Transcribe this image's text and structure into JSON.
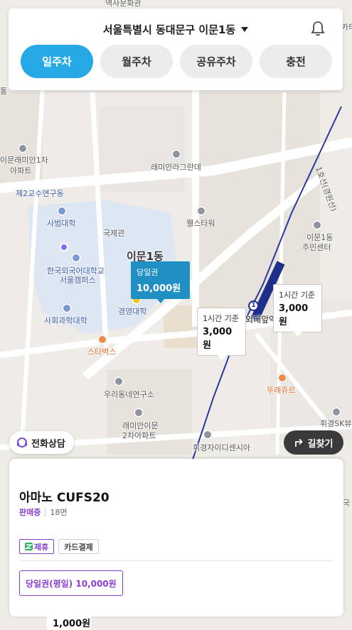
{
  "header": {
    "location": "서울특별시 동대문구 이문1동",
    "tabs": [
      {
        "label": "일주차",
        "active": true
      },
      {
        "label": "월주차",
        "active": false
      },
      {
        "label": "공유주차",
        "active": false
      },
      {
        "label": "충전",
        "active": false
      }
    ]
  },
  "map": {
    "labels": {
      "top_partial": "역사문화관",
      "left_apt_a": "이문래미안1차",
      "left_apt_b": "아파트",
      "research": "제2교수연구동",
      "edu": "사범대학",
      "faculty": "국제관",
      "district": "이문1동",
      "campus_a": "한국외국어대학교",
      "campus_b": "서울캠퍼스",
      "social": "사회과학대학",
      "business": "경영대학",
      "starbucks": "스타벅스",
      "center": "우리동네연구소",
      "apt2_a": "래미안이문",
      "apt2_b": "2차아파트",
      "raemian_green": "래미안라그란데",
      "wells": "웰스타워",
      "dong_center_a": "이문1동",
      "dong_center_b": "주민센터",
      "station": "외대앞역",
      "station_num": "1",
      "line": "1호선(경원선)",
      "tous": "뚜레쥬르",
      "hwigyeong_center": "휘경자이디센시아",
      "hwigyeong_sk": "휘경SK뷰",
      "right_edge": "국",
      "left_edge": "통",
      "top_right_edge": "카티"
    }
  },
  "markers": [
    {
      "sub": "당일권",
      "price": "10,000원",
      "primary": true
    },
    {
      "sub": "1시간 기준",
      "price": "3,000원",
      "primary": false
    },
    {
      "sub": "1시간 기준",
      "price": "3,000원",
      "primary": false
    }
  ],
  "buttons": {
    "call": "전화상담",
    "route": "길찾기"
  },
  "sheet": {
    "name": "아마노 CUFS20",
    "status": "판매중",
    "spaces": "18면",
    "tags": [
      "제휴",
      "카드결제"
    ],
    "ticket": "당일권(평일) 10,000원"
  },
  "next_card_price": "1,000원",
  "colors": {
    "accent": "#27a9e6",
    "marker_primary": "#1f8fc4",
    "purple": "#8a3fd0",
    "dark_button": "#3a3a3c",
    "subway_line": "#1d2f8a"
  }
}
